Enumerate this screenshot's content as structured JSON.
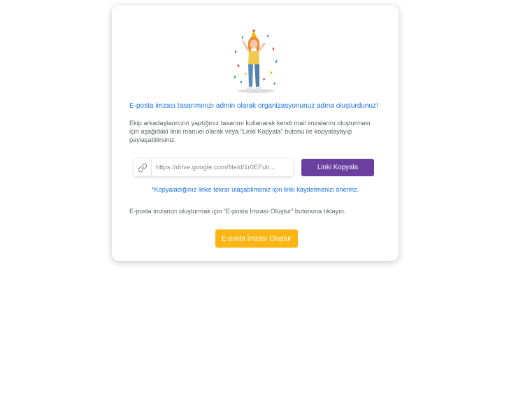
{
  "success": {
    "title": "E-posta imzası tasarımınızı admin olarak organizasyonunuz adına oluşturdunuz!",
    "description": "Ekip arkadaşlarınızın yaptığınız tasarımı kullanarak kendi mail imzalarını oluşturması için aşağıdaki linki manuel olarak veya “Linki Kopyala” butonu ile kopyalayayıp paylaşabilirsiniz."
  },
  "share_link": {
    "value": "https://drive.google.com/file/d/1r0EFuh...",
    "icon": "link-icon",
    "copy_label": "Linki Kopyala",
    "hint": "*Kopyaladığınız linke tekrar ulaşabilmeniz için linki kaydetmenizi öneririz."
  },
  "create": {
    "hint": "E-posta imzanızı oluşturmak için “E-posta İmzası Oluştur” butonuna tıklayın.",
    "button_label": "E-posta İmzası Oluştur"
  },
  "colors": {
    "link_text": "#1a73e8",
    "copy_button": "#6b3fa0",
    "create_button": "#fbb615"
  }
}
